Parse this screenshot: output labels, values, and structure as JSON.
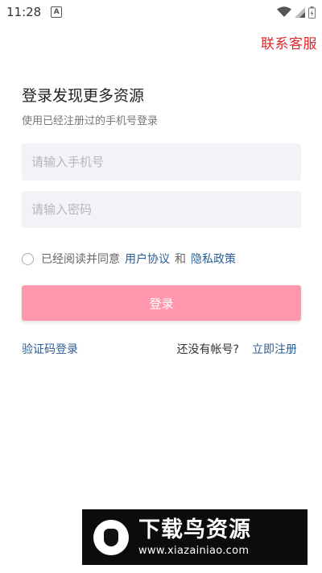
{
  "status_bar": {
    "time": "11:28",
    "notification_icon": "a-letter-icon",
    "icons": [
      "wifi-icon",
      "signal-icon",
      "battery-icon"
    ]
  },
  "header": {
    "contact_link": "联系客服"
  },
  "login": {
    "title": "登录发现更多资源",
    "subtitle": "使用已经注册过的手机号登录",
    "phone_placeholder": "请输入手机号",
    "password_placeholder": "请输入密码",
    "agree_prefix": "已经阅读并同意",
    "user_agreement": "用户协议",
    "and_text": "和",
    "privacy_policy": "隐私政策",
    "submit_label": "登录",
    "code_login": "验证码登录",
    "no_account": "还没有帐号?",
    "register_now": "立即注册"
  },
  "watermark": {
    "title": "下载鸟资源",
    "url": "www.xiazainiao.com"
  },
  "colors": {
    "accent_red": "#e0272d",
    "link_blue": "#2b5d95",
    "button_pink": "#ff98ad",
    "input_bg": "#f2f3f8"
  }
}
